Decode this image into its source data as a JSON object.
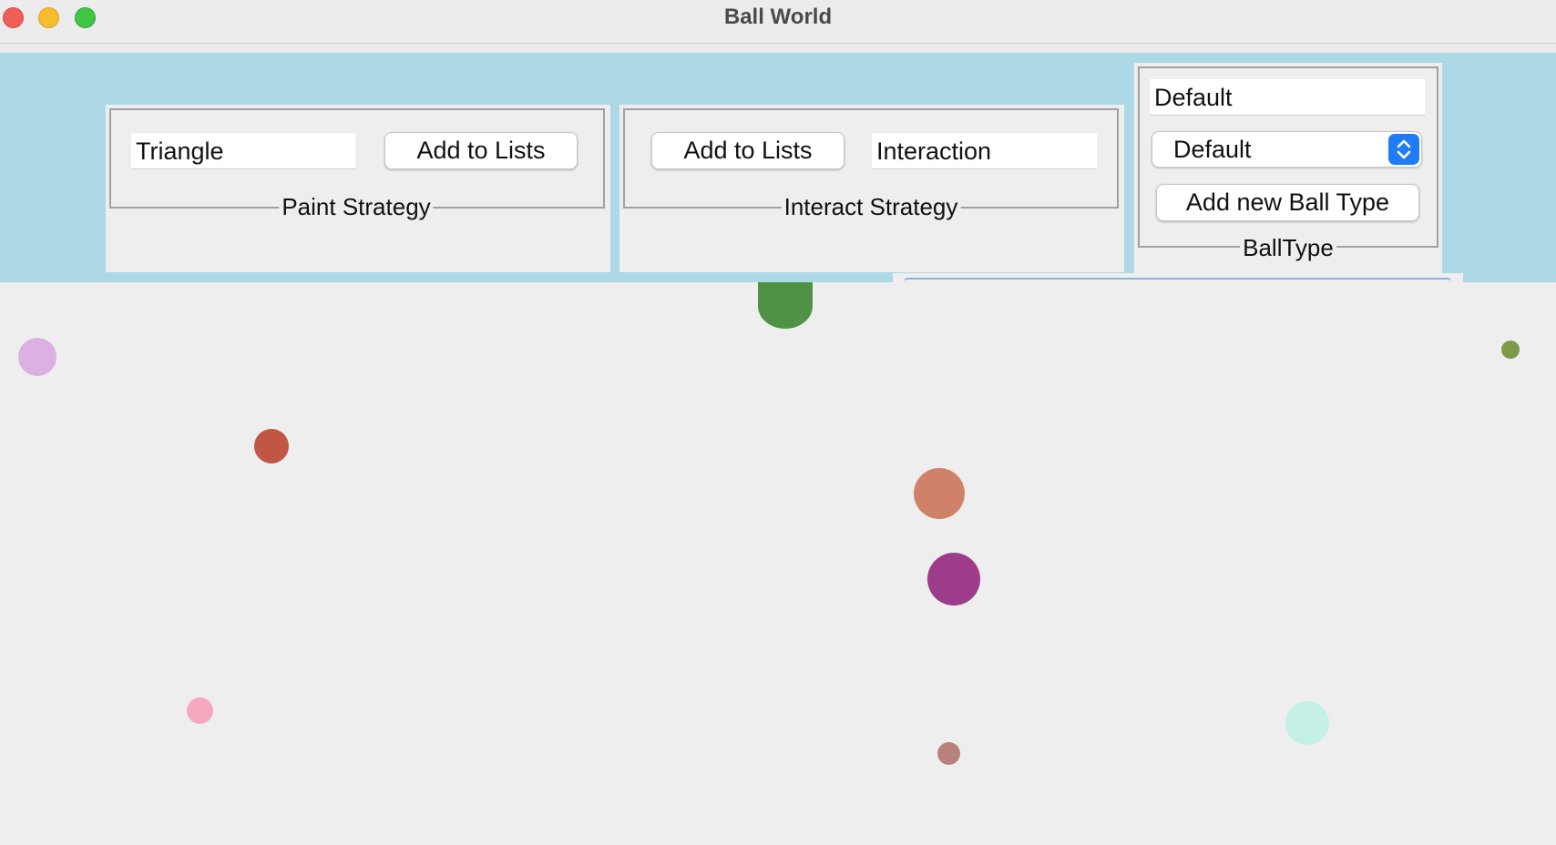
{
  "window": {
    "title": "Ball World"
  },
  "paint_strategy": {
    "title": "Paint Strategy",
    "input_value": "Triangle",
    "add_button": "Add to Lists"
  },
  "interact_strategy": {
    "title": "Interact Strategy",
    "add_button": "Add to Lists",
    "input_value": "Interaction"
  },
  "ball_type": {
    "title": "BallType",
    "input_value": "Default",
    "selected": "Default",
    "add_button": "Add new Ball Type"
  },
  "colors": {
    "control_panel": "#add8e6",
    "canvas": "#eeeeee"
  },
  "balls": [
    {
      "color": "#4f9245"
    },
    {
      "color": "#dcb0e2"
    },
    {
      "color": "#7d9a47"
    },
    {
      "color": "#c05644"
    },
    {
      "color": "#cf8269"
    },
    {
      "color": "#9c3c8a"
    },
    {
      "color": "#f6a8bf"
    },
    {
      "color": "#c4f0e6"
    },
    {
      "color": "#b7827a"
    }
  ]
}
